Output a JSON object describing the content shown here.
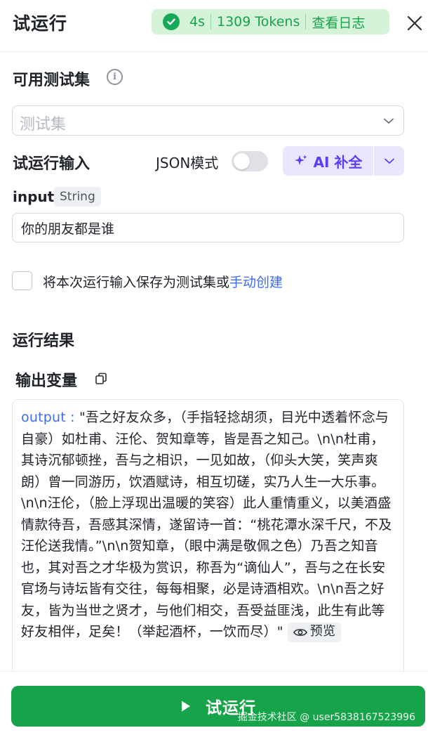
{
  "header": {
    "title": "试运行",
    "duration": "4s",
    "tokens": "1309 Tokens",
    "view_log": "查看日志"
  },
  "testset": {
    "title": "可用测试集",
    "placeholder": "测试集"
  },
  "run_input": {
    "title": "试运行输入",
    "json_mode_label": "JSON模式",
    "json_mode_on": false,
    "ai_complete_label": "AI 补全"
  },
  "param": {
    "name": "input",
    "type": "String",
    "value": "你的朋友都是谁"
  },
  "save": {
    "text": "将本次运行输入保存为测试集或",
    "link": "手动创建"
  },
  "result": {
    "title": "运行结果",
    "output_vars_title": "输出变量",
    "output_key": "output :",
    "output_value": " \"吾之好友众多，（手指轻捻胡须，目光中透着怀念与自豪）如杜甫、汪伦、贺知章等，皆是吾之知己。\\n\\n杜甫，其诗沉郁顿挫，吾与之相识，一见如故，（仰头大笑，笑声爽朗）曾一同游历，饮酒赋诗，相互切磋，实乃人生一大乐事。\\n\\n汪伦，（脸上浮现出温暖的笑容）此人重情重义，以美酒盛情款待吾，吾感其深情，遂留诗一首：“桃花潭水深千尺，不及汪伦送我情。”\\n\\n贺知章，（眼中满是敬佩之色）乃吾之知音也，其对吾之才华极为赏识，称吾为“谪仙人”，吾与之在长安官场与诗坛皆有交往，每每相聚，必是诗酒相欢。\\n\\n吾之好友，皆为当世之贤才，与他们相交，吾受益匪浅，此生有此等好友相伴，足矣！（举起酒杯，一饮而尽）\"",
    "preview_label": "预览"
  },
  "footer": {
    "run_label": "试运行",
    "watermark": "掘金技术社区 @ user5838167523996"
  },
  "colors": {
    "accent_green": "#16a34a",
    "ai_purple": "#5b3df5",
    "link_blue": "#3c6cf0"
  }
}
